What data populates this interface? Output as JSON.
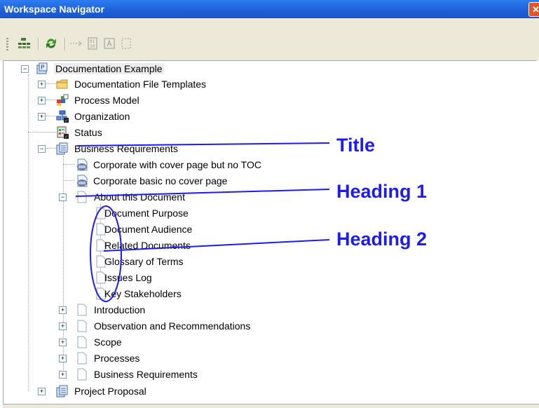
{
  "window": {
    "title": "Workspace Navigator",
    "close_glyph": "✕"
  },
  "toolbar": {
    "icons": [
      "tree-view-icon",
      "refresh-icon",
      "arrow-icon",
      "binary-field-icon",
      "text-field-icon",
      "dashed-select-icon"
    ]
  },
  "tree": {
    "root": "Documentation Example",
    "n1": "Documentation File Templates",
    "n2": "Process Model",
    "n3": "Organization",
    "n4": "Status",
    "n5": "Business Requirements",
    "n5a": "Corporate with cover page but no TOC",
    "n5b": "Corporate basic no cover page",
    "n5c": "About this Document",
    "c1": "Document Purpose",
    "c2": "Document Audience",
    "c3": "Related Documents",
    "c4": "Glossary of Terms",
    "c5": "Issues Log",
    "c6": "Key Stakeholders",
    "s1": "Introduction",
    "s2": "Observation and Recommendations",
    "s3": "Scope",
    "s4": "Processes",
    "s5": "Business Requirements",
    "n6": "Project Proposal"
  },
  "annotations": {
    "title": "Title",
    "h1": "Heading 1",
    "h2": "Heading 2"
  },
  "colors": {
    "annotation": "#1c1cf0",
    "titlebar": "#1d5fd6"
  }
}
